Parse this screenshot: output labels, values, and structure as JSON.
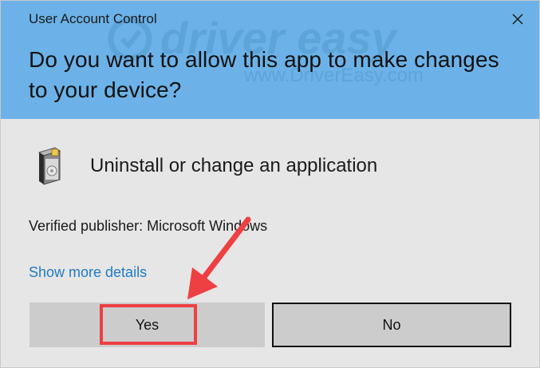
{
  "window": {
    "title": "User Account Control"
  },
  "header": {
    "question": "Do you want to allow this app to make changes to your device?",
    "background_color": "#6cb2e8",
    "watermark": {
      "brand": "driver easy",
      "url": "www.DriverEasy.com"
    }
  },
  "app": {
    "name": "Uninstall or change an application",
    "icon": "software-box-icon"
  },
  "publisher": {
    "text": "Verified publisher: Microsoft Windows"
  },
  "details": {
    "link_text": "Show more details",
    "color": "#1f7bc4"
  },
  "buttons": {
    "yes_label": "Yes",
    "no_label": "No"
  },
  "annotation": {
    "highlight_color": "#ee3f42",
    "arrow_icon": "red-arrow-icon"
  },
  "icons": {
    "close": "close-icon"
  }
}
